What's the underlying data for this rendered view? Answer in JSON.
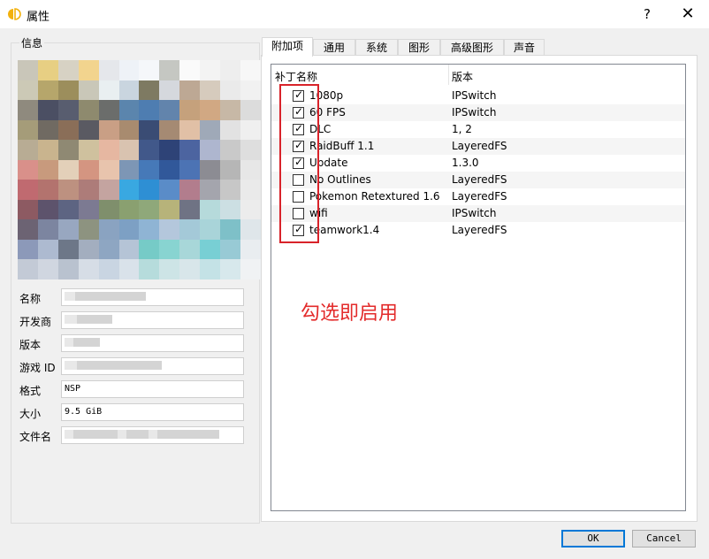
{
  "window": {
    "title": "属性",
    "help": "?",
    "close": "✕"
  },
  "info": {
    "group_title": "信息",
    "mosaic_colors": [
      "#c9c6b9",
      "#e7cf83",
      "#d7d2c4",
      "#f2d48e",
      "#e5e7eb",
      "#eef2f7",
      "#f5f7fa",
      "#c5c7c2",
      "#fafafa",
      "#f3f3f3",
      "#eeeeee",
      "#f7f7f7",
      "#ccc9b6",
      "#b6a66b",
      "#9c8e5c",
      "#c9c7b8",
      "#e9eff1",
      "#c9d5df",
      "#7e7a62",
      "#d5d8dd",
      "#bda894",
      "#d6cbbd",
      "#eaeaea",
      "#f1f1f1",
      "#8f8a7e",
      "#4b4f63",
      "#585d6f",
      "#8e8a6e",
      "#6b6d6b",
      "#5b85ad",
      "#4e7db1",
      "#6284ac",
      "#c5a17c",
      "#d1a883",
      "#c7b8a6",
      "#dcdcdc",
      "#a59c79",
      "#706a62",
      "#8a6e58",
      "#5a5a62",
      "#c99f85",
      "#a88b6f",
      "#3a4c74",
      "#a58a73",
      "#e1c0a6",
      "#9fa9b8",
      "#e2e2e2",
      "#efefef",
      "#b8ac94",
      "#c9b48e",
      "#8f8973",
      "#cfc19e",
      "#e6b7a1",
      "#d9c3b0",
      "#41588a",
      "#2e4377",
      "#4c64a0",
      "#aeb6cf",
      "#c9c9c9",
      "#dedede",
      "#d9908a",
      "#c89a7d",
      "#e3d0b9",
      "#d49581",
      "#e8c4ad",
      "#7d96b5",
      "#4679b8",
      "#31589a",
      "#4c73b4",
      "#8c8c93",
      "#b6b6b6",
      "#e7e7e7",
      "#c06a70",
      "#b3736e",
      "#bd9180",
      "#ad7c79",
      "#c4a4a0",
      "#39a8e1",
      "#2e8fd4",
      "#5a8cc8",
      "#b27d8d",
      "#a4a5ad",
      "#c7c7c7",
      "#eaeaea",
      "#8d5a62",
      "#5d536c",
      "#5d6482",
      "#7c7a92",
      "#7f8f6c",
      "#8aa070",
      "#8fa87a",
      "#b7b37a",
      "#6f7384",
      "#b6dadb",
      "#ccdfe3",
      "#ececec",
      "#6c6373",
      "#7c85a0",
      "#98a7c0",
      "#8d9380",
      "#8aa3c1",
      "#7da0c4",
      "#8fb4d4",
      "#b4c7dc",
      "#a4c9d8",
      "#a9d4d9",
      "#7ec0c8",
      "#dfe6ea",
      "#8c99b9",
      "#adbad0",
      "#6d7788",
      "#a3aebf",
      "#8ea6c2",
      "#b5c4d6",
      "#76cbc7",
      "#88d4d1",
      "#a8d7d9",
      "#78cfd4",
      "#98cad5",
      "#e9edf0",
      "#c3cad6",
      "#d0d6e0",
      "#b9c2cf",
      "#d6dde6",
      "#c9d5e2",
      "#d9e2ea",
      "#b6dcdc",
      "#cde4e6",
      "#d8e6ea",
      "#c4e2e6",
      "#d7e8ec",
      "#f0f2f4"
    ],
    "fields": [
      {
        "label": "名称",
        "value": ""
      },
      {
        "label": "开发商",
        "value": ""
      },
      {
        "label": "版本",
        "value": ""
      },
      {
        "label": "游戏 ID",
        "value": ""
      },
      {
        "label": "格式",
        "value": "NSP"
      },
      {
        "label": "大小",
        "value": "9.5 GiB"
      },
      {
        "label": "文件名",
        "value": ""
      }
    ]
  },
  "tabs": [
    {
      "label": "附加项",
      "active": true
    },
    {
      "label": "通用",
      "active": false
    },
    {
      "label": "系统",
      "active": false
    },
    {
      "label": "图形",
      "active": false
    },
    {
      "label": "高级图形",
      "active": false
    },
    {
      "label": "声音",
      "active": false
    }
  ],
  "addons": {
    "col_name": "补丁名称",
    "col_version": "版本",
    "rows": [
      {
        "name": "1080p",
        "version": "IPSwitch",
        "checked": true
      },
      {
        "name": "60 FPS",
        "version": "IPSwitch",
        "checked": true
      },
      {
        "name": "DLC",
        "version": "1, 2",
        "checked": true
      },
      {
        "name": "RaidBuff 1.1",
        "version": "LayeredFS",
        "checked": true
      },
      {
        "name": "Update",
        "version": "1.3.0",
        "checked": true
      },
      {
        "name": "No Outlines",
        "version": "LayeredFS",
        "checked": false
      },
      {
        "name": "Pokemon Retextured 1.6",
        "version": "LayeredFS",
        "checked": false
      },
      {
        "name": "wifi",
        "version": "IPSwitch",
        "checked": false
      },
      {
        "name": "teamwork1.4",
        "version": "LayeredFS",
        "checked": true
      }
    ]
  },
  "annotation": "勾选即启用",
  "buttons": {
    "ok": "OK",
    "cancel": "Cancel"
  },
  "colors": {
    "annotation_red": "#d8232a",
    "focus_blue": "#0078d7"
  }
}
